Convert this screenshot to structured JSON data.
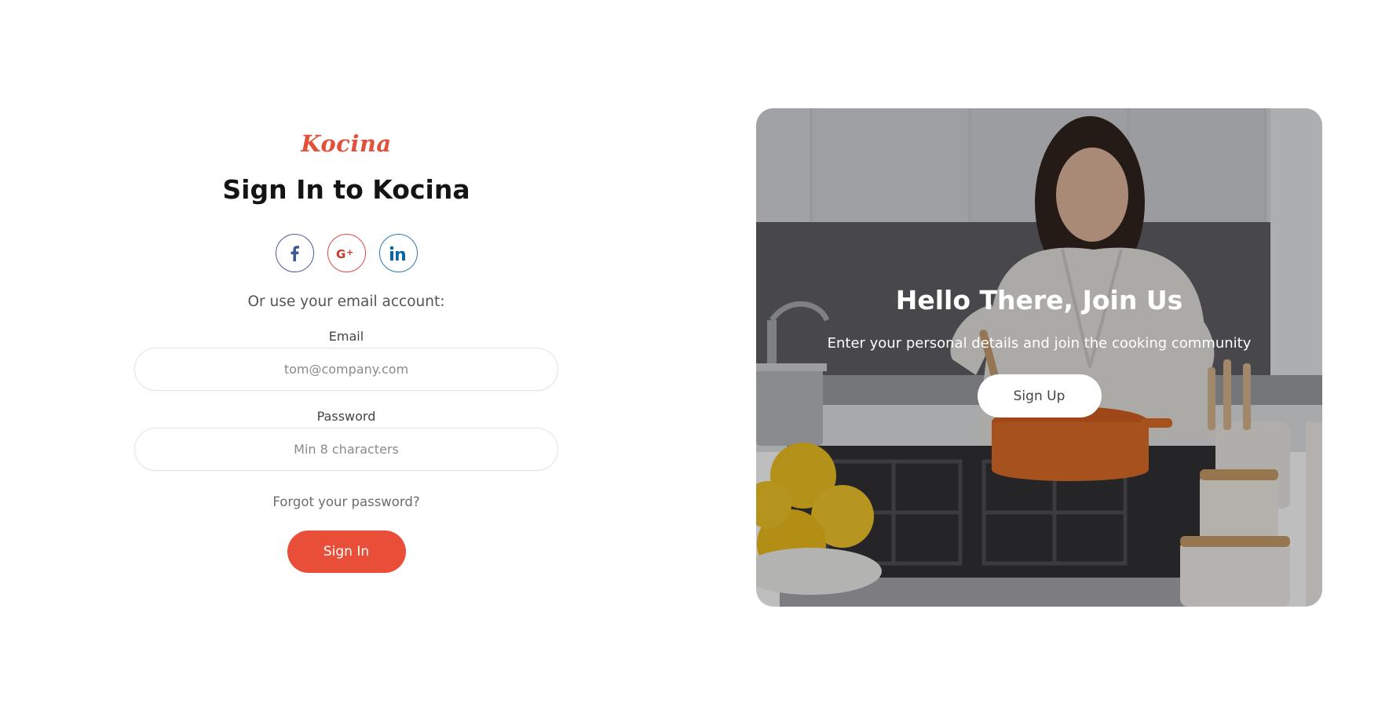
{
  "brand": {
    "logo": "Kocina",
    "accent_color": "#e94e38"
  },
  "signin": {
    "title": "Sign In to Kocina",
    "socials": [
      {
        "name": "facebook",
        "icon": "facebook-icon",
        "glyph": "f"
      },
      {
        "name": "google-plus",
        "icon": "google-plus-icon",
        "glyph": "G+"
      },
      {
        "name": "linkedin",
        "icon": "linkedin-icon",
        "glyph": "in"
      }
    ],
    "or_text": "Or use your email account:",
    "email": {
      "label": "Email",
      "placeholder": "tom@company.com",
      "value": ""
    },
    "password": {
      "label": "Password",
      "placeholder": "Min 8 characters",
      "value": ""
    },
    "forgot_label": "Forgot your password?",
    "submit_label": "Sign In"
  },
  "hero": {
    "title": "Hello There, Join Us",
    "subtitle": "Enter your personal details and join the cooking community",
    "cta_label": "Sign Up",
    "image": "kitchen-cooking-photo"
  }
}
